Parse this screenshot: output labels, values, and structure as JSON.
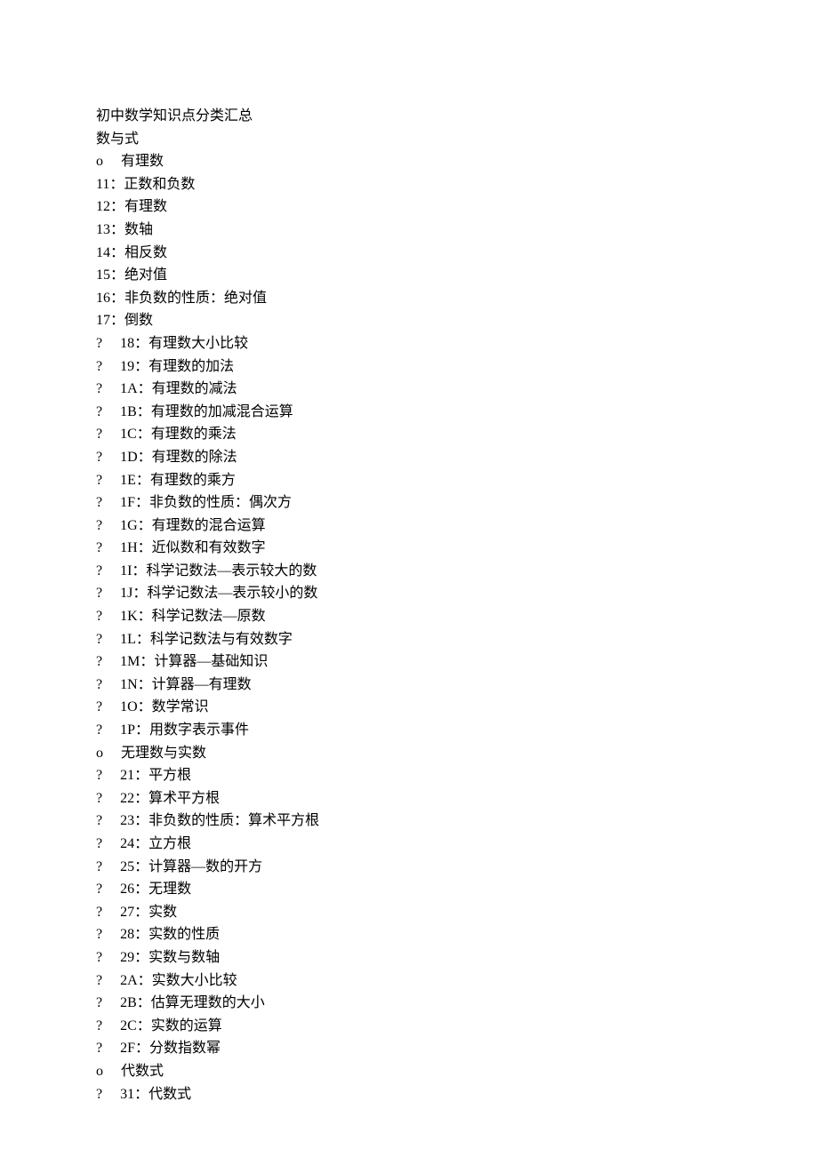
{
  "title": "初中数学知识点分类汇总",
  "section_heading": "数与式",
  "lines": [
    {
      "marker": "o",
      "text": "有理数"
    },
    {
      "marker": "",
      "text": "11：正数和负数"
    },
    {
      "marker": "",
      "text": "12：有理数"
    },
    {
      "marker": "",
      "text": "13：数轴"
    },
    {
      "marker": "",
      "text": "14：相反数"
    },
    {
      "marker": "",
      "text": "15：绝对值"
    },
    {
      "marker": "",
      "text": "16：非负数的性质：绝对值"
    },
    {
      "marker": "",
      "text": "17：倒数"
    },
    {
      "marker": "?",
      "text": "18：有理数大小比较"
    },
    {
      "marker": "?",
      "text": "19：有理数的加法"
    },
    {
      "marker": "?",
      "text": "1A：有理数的减法"
    },
    {
      "marker": "?",
      "text": "1B：有理数的加减混合运算"
    },
    {
      "marker": "?",
      "text": "1C：有理数的乘法"
    },
    {
      "marker": "?",
      "text": "1D：有理数的除法"
    },
    {
      "marker": "?",
      "text": "1E：有理数的乘方"
    },
    {
      "marker": "?",
      "text": "1F：非负数的性质：偶次方"
    },
    {
      "marker": "?",
      "text": "1G：有理数的混合运算"
    },
    {
      "marker": "?",
      "text": "1H：近似数和有效数字"
    },
    {
      "marker": "?",
      "text": "1I：科学记数法—表示较大的数"
    },
    {
      "marker": "?",
      "text": "1J：科学记数法—表示较小的数"
    },
    {
      "marker": "?",
      "text": "1K：科学记数法—原数"
    },
    {
      "marker": "?",
      "text": "1L：科学记数法与有效数字"
    },
    {
      "marker": "?",
      "text": "1M：计算器—基础知识"
    },
    {
      "marker": "?",
      "text": "1N：计算器—有理数"
    },
    {
      "marker": "?",
      "text": "1O：数学常识"
    },
    {
      "marker": "?",
      "text": "1P：用数字表示事件"
    },
    {
      "marker": "o",
      "text": "无理数与实数"
    },
    {
      "marker": "?",
      "text": "21：平方根"
    },
    {
      "marker": "?",
      "text": "22：算术平方根"
    },
    {
      "marker": "?",
      "text": "23：非负数的性质：算术平方根"
    },
    {
      "marker": "?",
      "text": "24：立方根"
    },
    {
      "marker": "?",
      "text": "25：计算器—数的开方"
    },
    {
      "marker": "?",
      "text": "26：无理数"
    },
    {
      "marker": "?",
      "text": "27：实数"
    },
    {
      "marker": "?",
      "text": "28：实数的性质"
    },
    {
      "marker": "?",
      "text": "29：实数与数轴"
    },
    {
      "marker": "?",
      "text": "2A：实数大小比较"
    },
    {
      "marker": "?",
      "text": "2B：估算无理数的大小"
    },
    {
      "marker": "?",
      "text": "2C：实数的运算"
    },
    {
      "marker": "?",
      "text": "2F：分数指数幂"
    },
    {
      "marker": "o",
      "text": "代数式"
    },
    {
      "marker": "?",
      "text": "31：代数式"
    }
  ]
}
